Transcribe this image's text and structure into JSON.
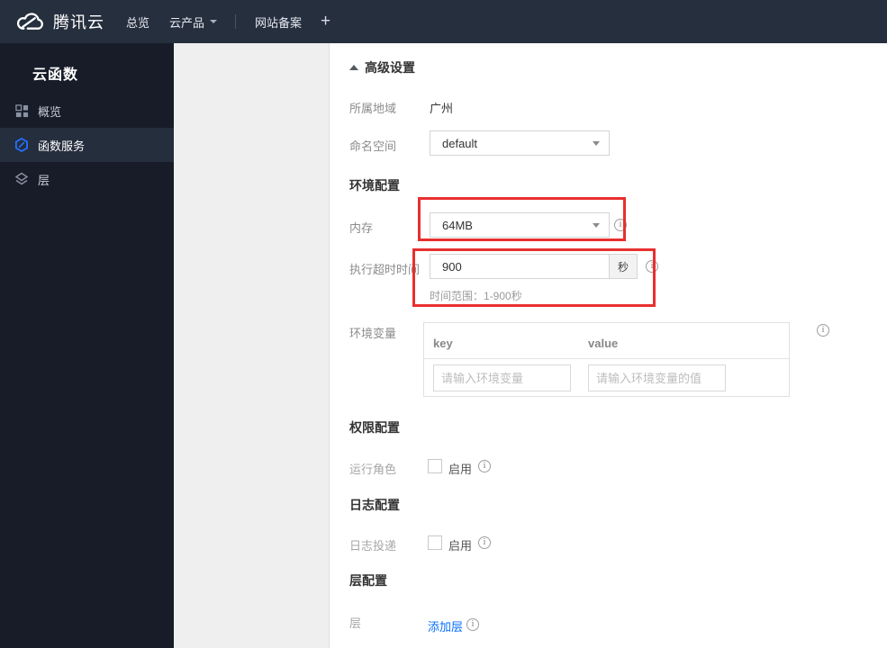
{
  "colors": {
    "navbar_bg": "#262f3e",
    "sidebar_bg": "#171c28",
    "sidebar_active_bg": "#252e3d",
    "accent_blue": "#0a6eff",
    "annotation_red": "#e82f2f"
  },
  "icons": {
    "brand": "cloud-logo",
    "overview": "grid-icon",
    "functions": "hexagon-function-icon",
    "layers": "layers-icon",
    "info": "info-circle-icon",
    "caret": "caret-down-icon",
    "collapse": "triangle-up-icon"
  },
  "navbar": {
    "brand": "腾讯云",
    "items": [
      {
        "label": "总览"
      },
      {
        "label": "云产品"
      },
      {
        "label": "网站备案"
      },
      {
        "label": "+"
      }
    ]
  },
  "sidebar": {
    "title": "云函数",
    "items": [
      {
        "label": "概览",
        "active": false
      },
      {
        "label": "函数服务",
        "active": true
      },
      {
        "label": "层",
        "active": false
      }
    ]
  },
  "form": {
    "advanced_toggle": "高级设置",
    "region": {
      "label": "所属地域",
      "value": "广州"
    },
    "namespace": {
      "label": "命名空间",
      "value": "default"
    },
    "env_section": "环境配置",
    "memory": {
      "label": "内存",
      "value": "64MB"
    },
    "timeout": {
      "label": "执行超时时间",
      "value": "900",
      "unit": "秒",
      "hint": "时间范围：1-900秒"
    },
    "env_vars": {
      "label": "环境变量",
      "key_header": "key",
      "value_header": "value",
      "key_placeholder": "请输入环境变量",
      "value_placeholder": "请输入环境变量的值"
    },
    "perm_section": "权限配置",
    "run_role": {
      "label": "运行角色",
      "enable": "启用"
    },
    "log_section": "日志配置",
    "log_delivery": {
      "label": "日志投递",
      "enable": "启用"
    },
    "layer_section": "层配置",
    "layer": {
      "label": "层",
      "add_link": "添加层"
    }
  }
}
